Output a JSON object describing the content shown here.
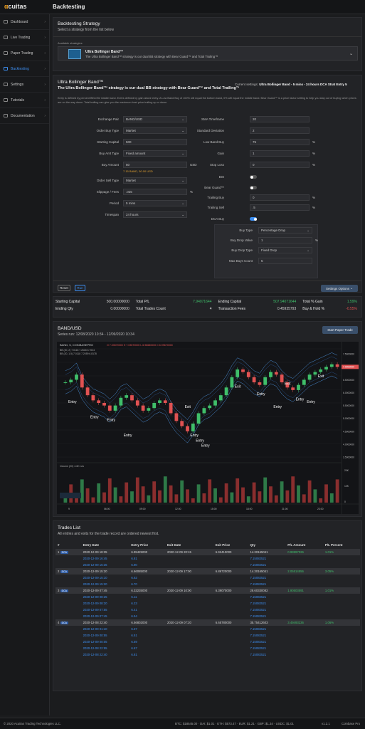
{
  "app": {
    "logo": "cuitas",
    "logo_mark": "α",
    "page_title": "Backtesting"
  },
  "sidebar": {
    "items": [
      {
        "label": "Dashboard",
        "icon": "dashboard-icon",
        "active": false
      },
      {
        "label": "Live Trading",
        "icon": "live-icon",
        "active": false
      },
      {
        "label": "Paper Trading",
        "icon": "paper-icon",
        "active": false
      },
      {
        "label": "Backtesting",
        "icon": "backtest-icon",
        "active": true
      },
      {
        "label": "Settings",
        "icon": "gear-icon",
        "active": false
      },
      {
        "label": "Tutorials",
        "icon": "video-icon",
        "active": false
      },
      {
        "label": "Documentation",
        "icon": "doc-icon",
        "active": false
      }
    ]
  },
  "strategy_select": {
    "title": "Backtesting Strategy",
    "subtitle": "Select a strategy from the list below",
    "avail_label": "Available strategies",
    "selected_name": "Ultra Bollinger Band™",
    "selected_desc": "The Ultra Bollinger Band™ strategy is our dual BB strategy with Bear Guard™ and Total Trailing™"
  },
  "strategy": {
    "name": "Ultra Bollinger Band™",
    "desc": "The Ultra Bollinger Band™ strategy is our dual BB strategy with Bear Guard™ and Total Trailing™",
    "current_settings_label": "Current settings:",
    "current_settings": "Ultra Bollinger Band - 5 mins - 24 hours DCA Strat Entry 5",
    "long_desc": "Entry is defined by percent BELOW middle band. Exit is defined by gain above entry. A Low Band Buy of 100% will equal the bottom band, 0% will equal the middle band. Bear Guard™ is a price factor setting to help you stay out of buying when prices are on the way down. Total trailing can give you the maximum best price trailing up or down."
  },
  "form": {
    "left": [
      {
        "label": "Exchange Pair",
        "value": "BAND/USD",
        "type": "select"
      },
      {
        "label": "Order Buy Type",
        "value": "Market",
        "type": "select"
      },
      {
        "label": "Starting Capital",
        "value": "500",
        "type": "input"
      },
      {
        "label": "Buy Amt Type",
        "value": "Fixed amount",
        "type": "select"
      },
      {
        "label": "Buy Amount",
        "value": "50",
        "type": "input",
        "suffix": "USD"
      },
      {
        "label": "Order Sell Type",
        "value": "Market",
        "type": "select"
      },
      {
        "label": "Slippage / Fees",
        "value": ".025",
        "type": "input",
        "suffix": "%"
      },
      {
        "label": "Period",
        "value": "5 mins",
        "type": "select"
      },
      {
        "label": "Timespan",
        "value": "24 hours",
        "type": "select"
      }
    ],
    "buy_note": "7.15 BAND, 50.00 USD",
    "right": [
      {
        "label": "SMA Timeframe",
        "value": "20",
        "type": "input"
      },
      {
        "label": "Standard Deviation",
        "value": "2",
        "type": "input"
      },
      {
        "label": "Low Band Buy",
        "value": "75",
        "type": "input",
        "suffix": "%"
      },
      {
        "label": "Gain",
        "value": "1",
        "type": "input",
        "suffix": "%"
      },
      {
        "label": "Stop Loss",
        "value": "0",
        "type": "input",
        "suffix": "%"
      },
      {
        "label": "BSI",
        "type": "toggle",
        "on": false
      },
      {
        "label": "Bear Guard™",
        "type": "toggle",
        "on": false
      },
      {
        "label": "Trailing Buy",
        "value": "0",
        "type": "input",
        "suffix": "%"
      },
      {
        "label": "Trailing Sell",
        "value": ".5",
        "type": "input",
        "suffix": "%"
      },
      {
        "label": "DCA Buy",
        "type": "toggle",
        "on": true
      }
    ],
    "dca": [
      {
        "label": "Buy Type",
        "value": "Percentage Drop",
        "type": "select"
      },
      {
        "label": "Buy Drop Value",
        "value": "1",
        "type": "input",
        "suffix": "%"
      },
      {
        "label": "Buy Drop Type",
        "value": "Fixed Drop",
        "type": "select"
      },
      {
        "label": "Max Buys Count",
        "value": "5",
        "type": "input"
      }
    ],
    "reset": "Reset",
    "run": "Run",
    "settings_options": "Settings Options"
  },
  "stats": [
    [
      {
        "k": "Starting Capital",
        "v": "500.00000000",
        "c": ""
      },
      {
        "k": "Total P/L",
        "v": "7.94071644",
        "c": "green"
      },
      {
        "k": "Ending Capital",
        "v": "507.94071644",
        "c": "green"
      },
      {
        "k": "Total % Gain",
        "v": "1.59%",
        "c": "green"
      }
    ],
    [
      {
        "k": "Ending Qty",
        "v": "0.00000000",
        "c": ""
      },
      {
        "k": "Total Trades Count",
        "v": "4",
        "c": ""
      },
      {
        "k": "Transaction Fees",
        "v": "0.45935793",
        "c": ""
      },
      {
        "k": "Buy & Hold %",
        "v": "-0.55%",
        "c": "red"
      }
    ]
  ],
  "chart_panel": {
    "title": "BAND/USD",
    "series_run": "Series run: 12/08/2020 10:34 - 12/09/2020 10:34",
    "start_paper": "Start Paper Trade"
  },
  "chart_data": {
    "type": "candlestick",
    "symbol": "BAND, 5, COINBASEPRO",
    "ohlc": "O 7.03570000 H 7.03570000 L 6.98680000 C 6.99670000",
    "bb_lines": [
      "BB (20, 2) 7.0118 7.2618 6.7024",
      "BB (20, 1.5) 7.0118 7.2059 6.8178"
    ],
    "last_price": "7.0000000",
    "y_ticks": [
      "7.5000000",
      "7.0000000",
      "6.5000000",
      "6.0000000",
      "5.5000000",
      "5.0000000",
      "4.5000000",
      "4.0000000",
      "3.5000000"
    ],
    "x_ticks": [
      "9",
      "06:00",
      "09:00",
      "12:00",
      "15:00",
      "18:00",
      "21:00",
      "23:00"
    ],
    "volume_label": "Volume (20)",
    "volume_vals": "4.6K n/a",
    "vol_ticks": [
      "20K",
      "10K",
      "0"
    ],
    "closes": [
      6.4,
      6.5,
      6.7,
      6.2,
      5.9,
      5.7,
      5.6,
      5.5,
      5.3,
      5.5,
      5.8,
      5.9,
      5.7,
      5.5,
      5.3,
      5.4,
      5.6,
      5.7,
      5.6,
      5.2,
      4.9,
      4.7,
      4.5,
      4.8,
      5.2,
      5.4,
      5.5,
      5.7,
      5.9,
      6.2,
      6.6,
      6.9,
      6.8,
      6.6,
      6.4,
      6.3,
      6.6,
      6.8,
      6.7,
      6.4,
      6.2,
      6.1,
      6.3,
      6.5,
      6.7,
      6.8,
      6.9,
      7.0,
      7.1,
      7.0
    ],
    "annotations": [
      {
        "t": "Entry"
      },
      {
        "t": "Entry"
      },
      {
        "t": "Entry"
      },
      {
        "t": "Entry"
      },
      {
        "t": "Exit"
      },
      {
        "t": "Entry"
      },
      {
        "t": "Entry"
      },
      {
        "t": "Entry"
      },
      {
        "t": "Exit"
      },
      {
        "t": "Entry"
      },
      {
        "t": "Entry"
      },
      {
        "t": "Exit"
      },
      {
        "t": "Entry"
      },
      {
        "t": "Entry"
      },
      {
        "t": "Exit"
      }
    ]
  },
  "trades": {
    "title": "Trades List",
    "subtitle": "All entries and exits for the trade record are ordered newest first.",
    "headers": [
      "#",
      "Entry Date",
      "Entry Price",
      "Exit Date",
      "Exit Price",
      "Qty",
      "P/L Amount",
      "P/L Percent"
    ],
    "rows": [
      {
        "main": true,
        "n": "1",
        "b": "DCA",
        "ed": "2020-12-09 18:35",
        "ep": "6.95425000",
        "xd": "2020-12-09 20:15",
        "xp": "6.92410000",
        "q": "14.30165041",
        "pl": "0.99997026",
        "pp": "1.01%"
      },
      {
        "ed": "2020-12-09 16:45",
        "ep": "6.81",
        "q": "7.15082521"
      },
      {
        "ed": "2020-12-09 15:35",
        "ep": "6.90",
        "q": "7.15082521"
      },
      {
        "main": true,
        "n": "2",
        "b": "DCA",
        "ed": "2020-12-09 15:20",
        "ep": "6.66085000",
        "xd": "2020-12-09 17:00",
        "xp": "6.86720000",
        "q": "14.30165041",
        "pl": "2.05514556",
        "pp": "3.05%"
      },
      {
        "ed": "2020-12-09 15:10",
        "ep": "6.62",
        "q": "7.15082521"
      },
      {
        "ed": "2020-12-09 15:20",
        "ep": "6.70",
        "q": "7.15082521"
      },
      {
        "main": true,
        "n": "3",
        "b": "DCA",
        "ed": "2020-12-09 07:45",
        "ep": "6.32235000",
        "xd": "2020-12-09 10:00",
        "xp": "6.39070000",
        "q": "28.60330082",
        "pl": "1.90503591",
        "pp": "1.01%"
      },
      {
        "ed": "2020-12-09 08:25",
        "ep": "6.11",
        "q": "7.15082521"
      },
      {
        "ed": "2020-12-09 08:20",
        "ep": "6.23",
        "q": "7.15082521"
      },
      {
        "ed": "2020-12-09 07:55",
        "ep": "6.41",
        "q": "7.15082521"
      },
      {
        "ed": "2020-12-09 07:45",
        "ep": "6.54",
        "q": "7.15082521"
      },
      {
        "main": true,
        "n": "4",
        "b": "DCA",
        "ed": "2020-12-08 22:40",
        "ep": "6.56802000",
        "xd": "2020-12-09 07:20",
        "xp": "6.65780000",
        "q": "35.75412603",
        "pl": "3.49493236",
        "pp": "1.06%"
      },
      {
        "ed": "2020-12-09 01:10",
        "ep": "6.37",
        "q": "7.15082521"
      },
      {
        "ed": "2020-12-09 00:55",
        "ep": "6.51",
        "q": "7.15082521"
      },
      {
        "ed": "2020-12-09 00:05",
        "ep": "6.59",
        "q": "7.15082521"
      },
      {
        "ed": "2020-12-08 22:55",
        "ep": "6.67",
        "q": "7.15082521"
      },
      {
        "ed": "2020-12-08 22:40",
        "ep": "6.81",
        "q": "7.15082521"
      }
    ]
  },
  "footer": {
    "copyright": "© 2020 Acuitas Trading Technologies LLC.",
    "tickers": "BTC: $18545.00 · DAI: $1.01 · ETH: $573.47 · EUR: $1.21 · GBP: $1.34 · USDC: $1.01",
    "version": "v1.2.1",
    "exchange": "Coinbase Pro"
  }
}
